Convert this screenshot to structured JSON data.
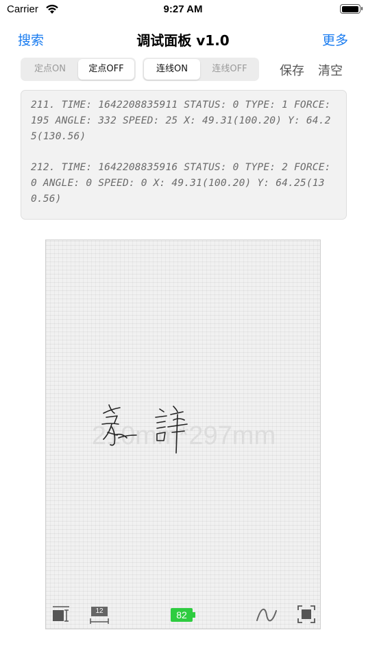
{
  "status_bar": {
    "carrier": "Carrier",
    "time": "9:27 AM",
    "battery_level": 1.0
  },
  "nav": {
    "left": "搜索",
    "title": "调试面板 v1.0",
    "right": "更多"
  },
  "toolbar": {
    "fixed_point_on": "定点ON",
    "fixed_point_off": "定点OFF",
    "line_on": "连线ON",
    "line_off": "连线OFF",
    "save": "保存",
    "clear": "清空"
  },
  "log": {
    "entries": [
      "211. TIME: 1642208835911 STATUS: 0 TYPE: 1 FORCE: 195 ANGLE: 332 SPEED: 25 X: 49.31(100.20) Y: 64.25(130.56)",
      "212. TIME: 1642208835916 STATUS: 0 TYPE: 2 FORCE: 0 ANGLE: 0 SPEED: 0 X: 49.31(100.20) Y: 64.25(130.56)"
    ]
  },
  "paper": {
    "size_label": "210mm*297mm",
    "pen_size": "12",
    "device_battery": "82"
  },
  "colors": {
    "accent": "#1a7cf0",
    "battery_green": "#2ecc40",
    "log_text": "#6a6a6a"
  },
  "icons": {
    "wifi": "wifi-icon",
    "pen_width": "pen-width-icon",
    "pen_size": "pen-size-icon",
    "device_battery": "device-battery-icon",
    "curve": "curve-icon",
    "fullscreen": "fullscreen-icon"
  }
}
